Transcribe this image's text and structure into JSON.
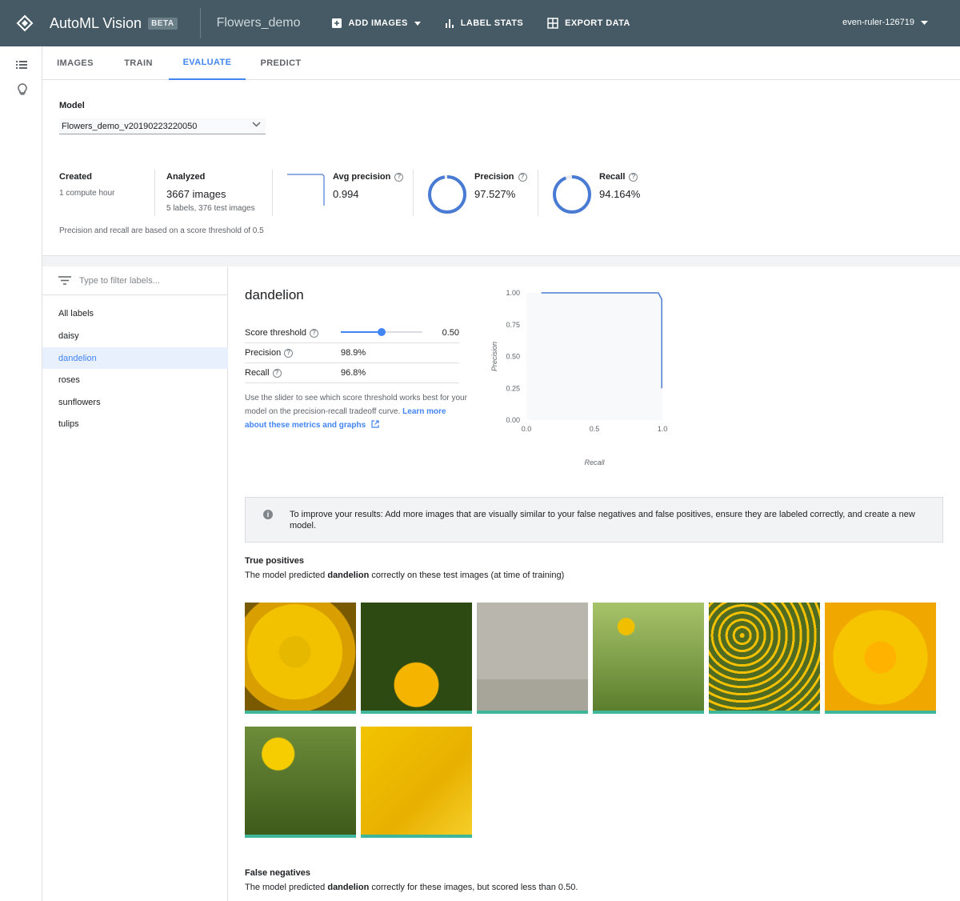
{
  "header": {
    "app_title": "AutoML Vision",
    "beta": "BETA",
    "dataset": "Flowers_demo",
    "actions": [
      {
        "label": "ADD IMAGES",
        "icon": "add-box-icon"
      },
      {
        "label": "LABEL STATS",
        "icon": "bar-chart-icon"
      },
      {
        "label": "EXPORT DATA",
        "icon": "grid-icon"
      }
    ],
    "project": "even-ruler-126719"
  },
  "tabs": [
    "IMAGES",
    "TRAIN",
    "EVALUATE",
    "PREDICT"
  ],
  "active_tab": "EVALUATE",
  "model": {
    "label": "Model",
    "selected": "Flowers_demo_v20190223220050"
  },
  "stats": {
    "created_title": "Created",
    "created_value": "1 compute hour",
    "analyzed_title": "Analyzed",
    "analyzed_value": "3667 images",
    "analyzed_detail": "5 labels, 376 test images",
    "avg_precision_title": "Avg precision",
    "avg_precision_value": "0.994",
    "precision_title": "Precision",
    "precision_value": "97.527%",
    "recall_title": "Recall",
    "recall_value": "94.164%",
    "precision_fraction": 0.97527,
    "recall_fraction": 0.94164,
    "threshold_note": "Precision and recall are based on a score threshold of 0.5"
  },
  "labels_panel": {
    "filter_placeholder": "Type to filter labels...",
    "items": [
      "All labels",
      "daisy",
      "dandelion",
      "roses",
      "sunflowers",
      "tulips"
    ],
    "selected": "dandelion"
  },
  "detail": {
    "title": "dandelion",
    "score_threshold_label": "Score threshold",
    "score_threshold_value": "0.50",
    "score_threshold_fraction": 0.5,
    "precision_label": "Precision",
    "precision_value": "98.9%",
    "recall_label": "Recall",
    "recall_value": "96.8%",
    "description": "Use the slider to see which score threshold works best for your model on the precision-recall tradeoff curve.",
    "learn_more": "Learn more about these metrics and graphs"
  },
  "chart_data": {
    "type": "line",
    "title": "",
    "xlabel": "Recall",
    "ylabel": "Precision",
    "xlim": [
      0,
      1
    ],
    "ylim": [
      0,
      1
    ],
    "x_ticks": [
      "0.0",
      "0.5",
      "1.0"
    ],
    "y_ticks": [
      "1.00",
      "0.75",
      "0.50",
      "0.25",
      "0.00"
    ],
    "series": [
      {
        "x": [
          0.11,
          0.97,
          0.975,
          0.985,
          0.99,
          0.995,
          0.995
        ],
        "y": [
          1.0,
          1.0,
          0.99,
          0.97,
          0.96,
          0.95,
          0.25
        ]
      }
    ],
    "color": "#4a7bd4"
  },
  "info_box": {
    "text": "To improve your results: Add more images that are visually similar to your false negatives and false positives, ensure they are labeled correctly, and create a new model."
  },
  "true_positives": {
    "title": "True positives",
    "sub_before": "The model predicted ",
    "sub_label": "dandelion",
    "sub_after": " correctly on these test images (at time of training)",
    "count": 8
  },
  "false_negatives": {
    "title": "False negatives",
    "sub_before": "The model predicted ",
    "sub_label": "dandelion",
    "sub_after": " correctly for these images, but scored less than 0.50."
  }
}
